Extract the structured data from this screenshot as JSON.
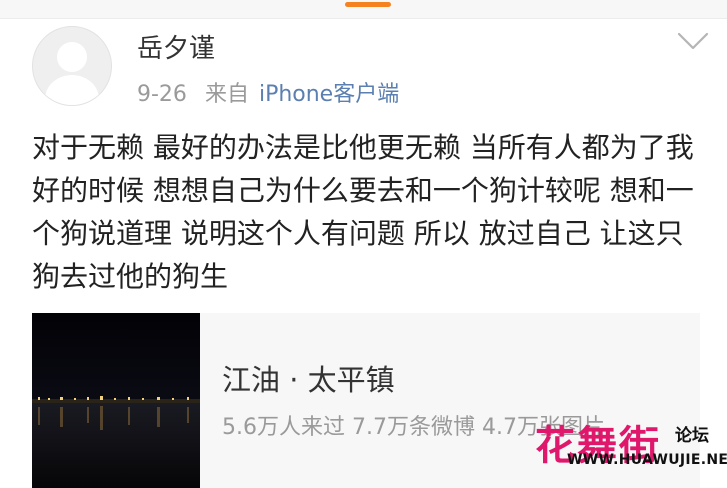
{
  "post": {
    "author": "岳夕谨",
    "date": "9-26",
    "source_prefix": "来自",
    "source": "iPhone客户端",
    "text": "对于无赖 最好的办法是比他更无赖 当所有人都为了我好的时候 想想自己为什么要去和一个狗计较呢 想和一个狗说道理 说明这个人有问题 所以 放过自己 让这只狗去过他的狗生"
  },
  "location_card": {
    "title": "江油 · 太平镇",
    "stats": "5.6万人来过 7.7万条微博 4.7万张图片"
  },
  "watermark": {
    "logo": "花舞街",
    "badge": "论坛",
    "url": "WWW.HUAWUJIE.NET"
  },
  "icons": {
    "avatar": "default-avatar-icon",
    "menu": "chevron-down-icon",
    "pull": "pull-indicator"
  },
  "colors": {
    "accent": "#f6821f",
    "link": "#5b7fb0",
    "watermark": "#e0186c"
  }
}
